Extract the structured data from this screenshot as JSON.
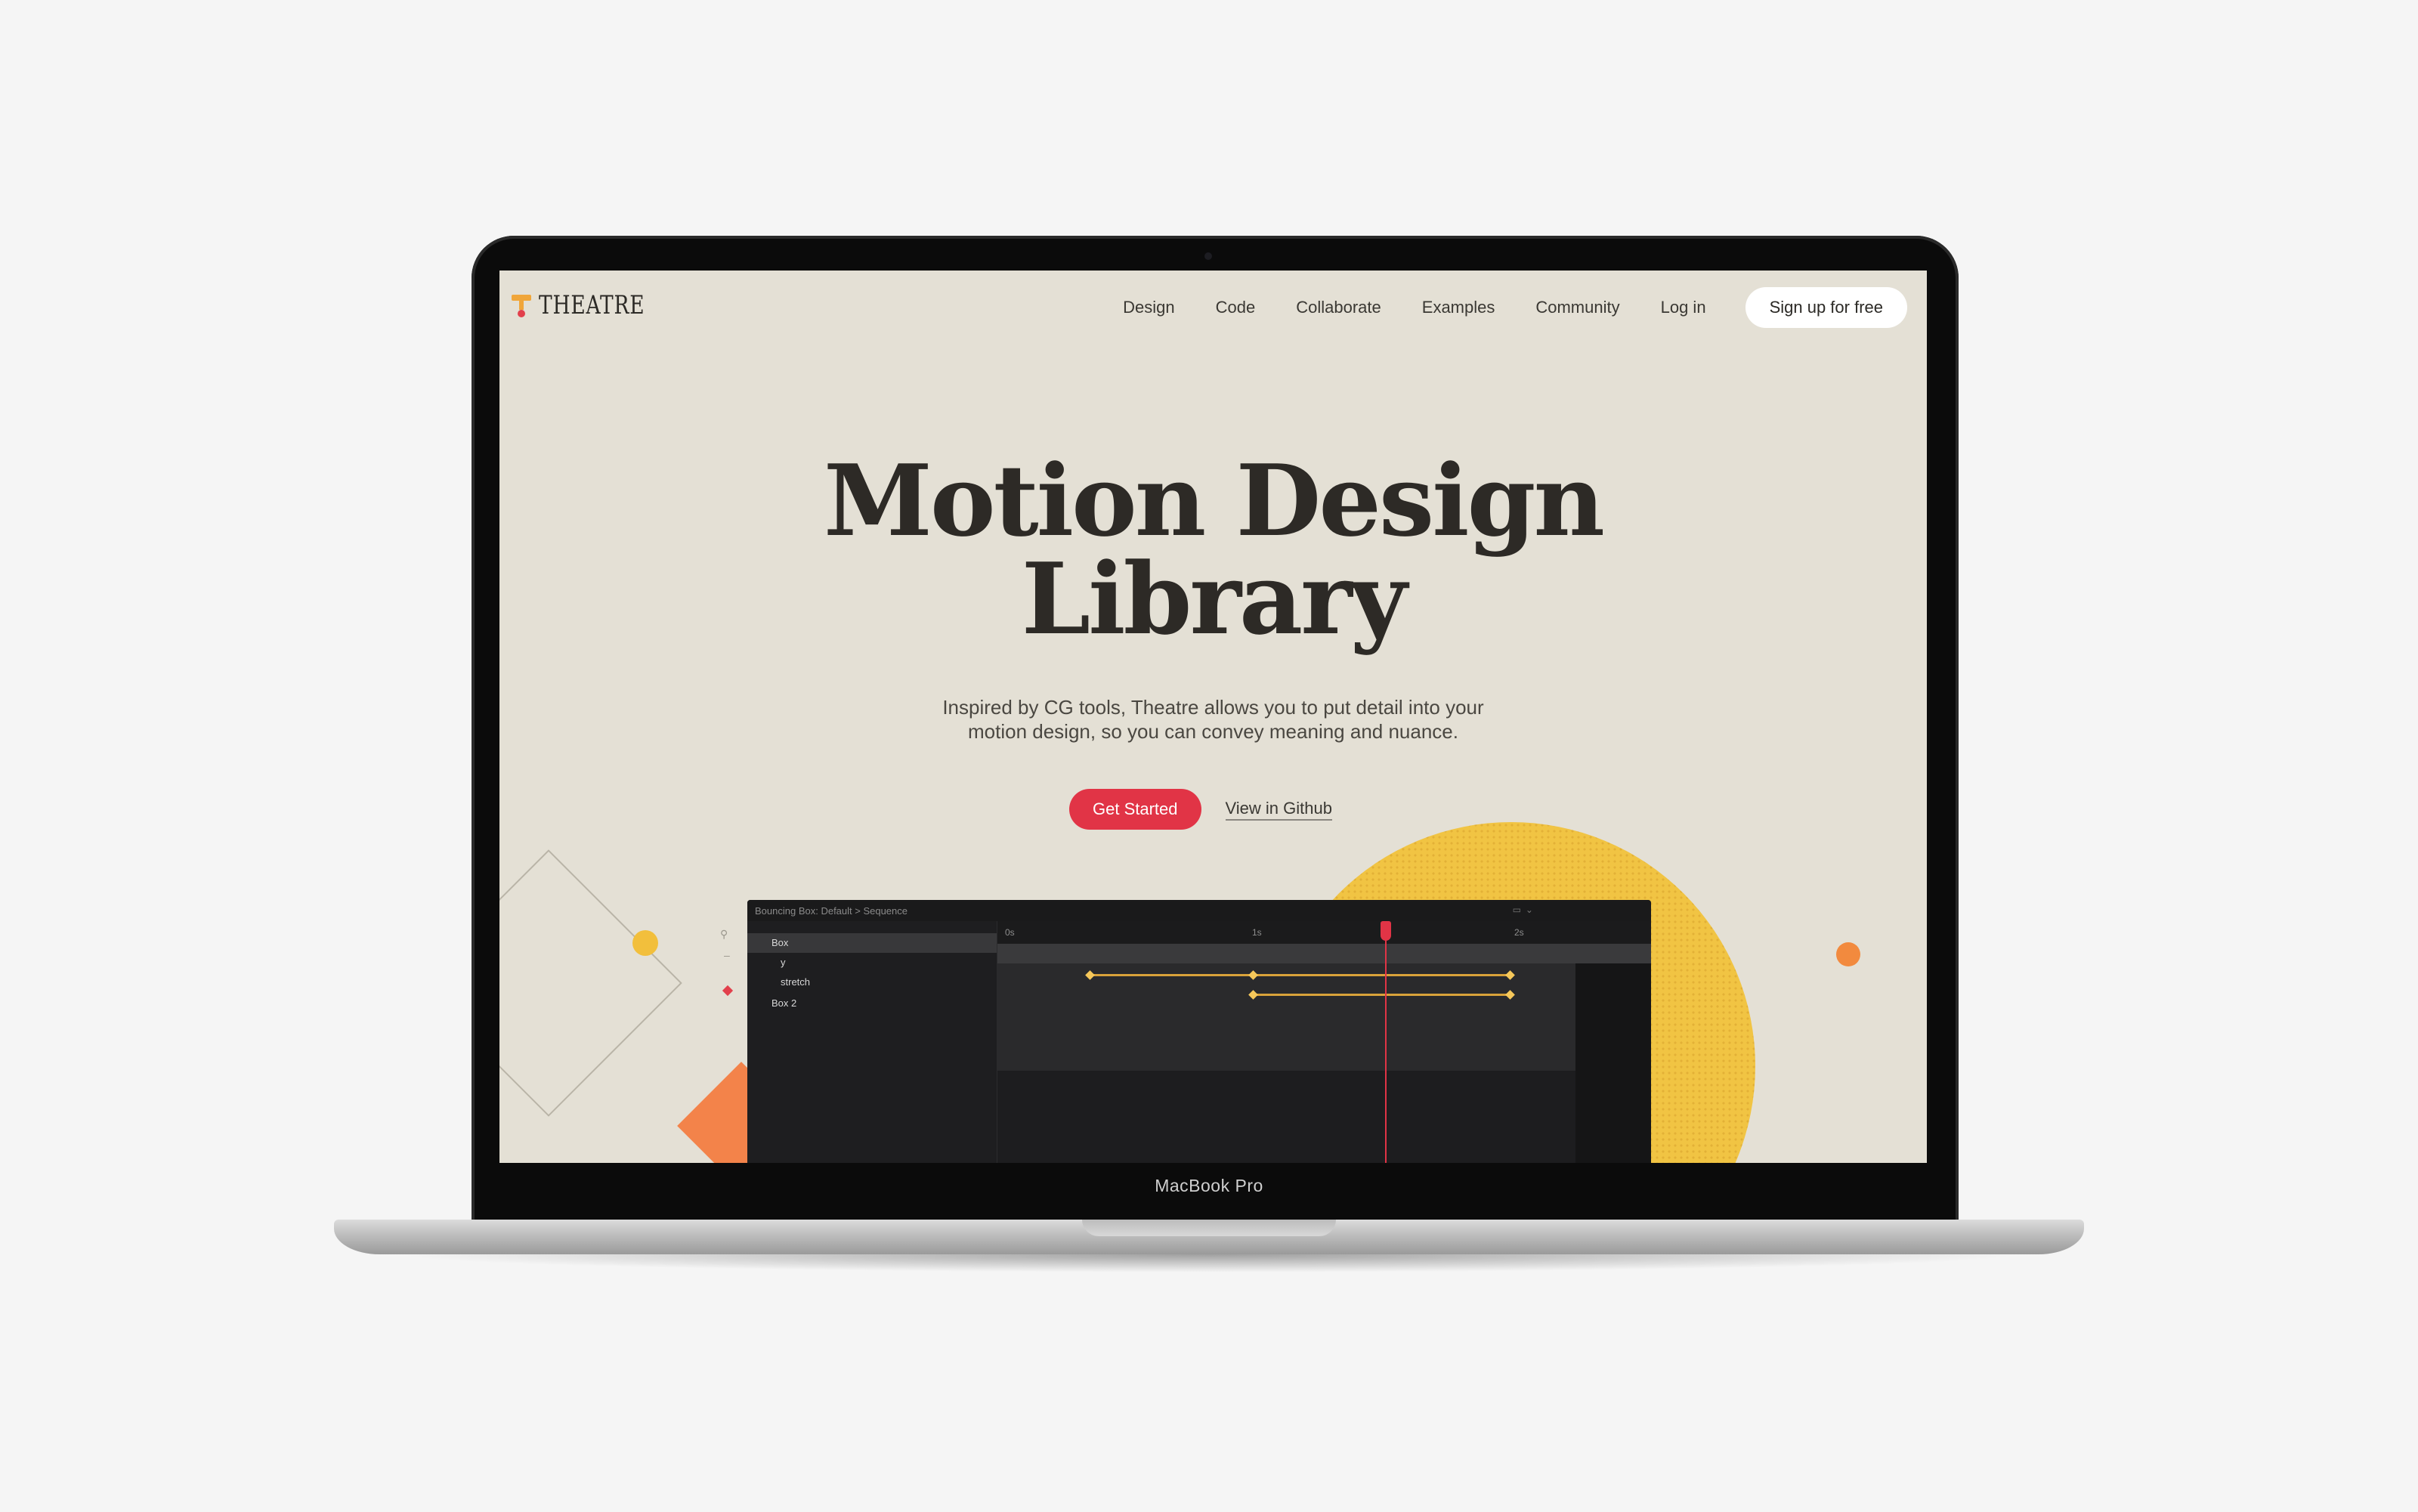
{
  "device": {
    "model_label": "MacBook Pro"
  },
  "site": {
    "logo_text": "THEATRE",
    "nav": {
      "items": [
        "Design",
        "Code",
        "Collaborate",
        "Examples",
        "Community",
        "Log in"
      ],
      "signup_label": "Sign up for free"
    },
    "hero": {
      "title_line1": "Motion Design",
      "title_line2": "Library",
      "subtitle_line1": "Inspired by CG tools, Theatre allows you to put detail into your",
      "subtitle_line2": "motion design, so you can convey meaning and nuance.",
      "primary_cta": "Get Started",
      "secondary_cta": "View in Github"
    },
    "editor": {
      "title": "Bouncing Box: Default  > Sequence",
      "ruler_ticks": [
        "0s",
        "1s",
        "2s"
      ],
      "tree": [
        "Box",
        "y",
        "stretch",
        "Box 2"
      ]
    }
  },
  "colors": {
    "page_bg": "#f5f5f5",
    "screen_bg": "#e4e0d5",
    "accent_red": "#e13446",
    "sun_yellow": "#f1c443",
    "accent_orange": "#f3834a",
    "editor_bg": "#1d1d1f"
  },
  "icons": [
    "logo-mark-icon",
    "search-icon",
    "diamond-shape"
  ]
}
